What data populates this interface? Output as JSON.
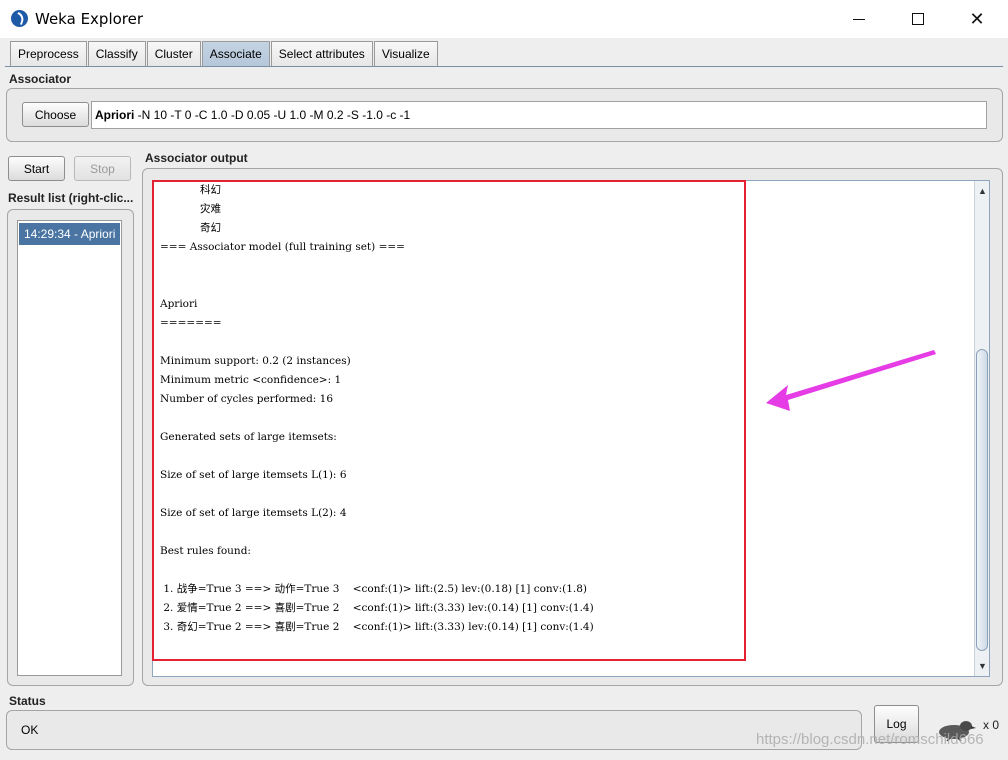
{
  "window": {
    "title": "Weka Explorer",
    "controls": {
      "minimize": "minimize-icon",
      "maximize": "maximize-icon",
      "close": "close-icon"
    }
  },
  "tabs": [
    {
      "label": "Preprocess",
      "active": false
    },
    {
      "label": "Classify",
      "active": false
    },
    {
      "label": "Cluster",
      "active": false
    },
    {
      "label": "Associate",
      "active": true
    },
    {
      "label": "Select attributes",
      "active": false
    },
    {
      "label": "Visualize",
      "active": false
    }
  ],
  "associator": {
    "section_label": "Associator",
    "choose_label": "Choose",
    "algorithm": "Apriori",
    "options": " -N 10 -T 0 -C 1.0 -D 0.05 -U 1.0 -M 0.2 -S -1.0 -c -1"
  },
  "controls": {
    "start_label": "Start",
    "stop_label": "Stop"
  },
  "result_list": {
    "label": "Result list (right-clic...",
    "items": [
      "14:29:34 - Apriori"
    ]
  },
  "output": {
    "label": "Associator output",
    "lines": [
      "            科幻",
      "            灾难",
      "            奇幻",
      "=== Associator model (full training set) ===",
      "",
      "",
      "Apriori",
      "=======",
      "",
      "Minimum support: 0.2 (2 instances)",
      "Minimum metric <confidence>: 1",
      "Number of cycles performed: 16",
      "",
      "Generated sets of large itemsets:",
      "",
      "Size of set of large itemsets L(1): 6",
      "",
      "Size of set of large itemsets L(2): 4",
      "",
      "Best rules found:",
      "",
      " 1. 战争=True 3 ==> 动作=True 3    <conf:(1)> lift:(2.5) lev:(0.18) [1] conv:(1.8)",
      " 2. 爱情=True 2 ==> 喜剧=True 2    <conf:(1)> lift:(3.33) lev:(0.14) [1] conv:(1.4)",
      " 3. 奇幻=True 2 ==> 喜剧=True 2    <conf:(1)> lift:(3.33) lev:(0.14) [1] conv:(1.4)"
    ],
    "scroll": {
      "up": "▲",
      "down": "▼"
    }
  },
  "annotations": {
    "highlight_color": "#e52232",
    "arrow_color": "#e53ce6"
  },
  "status": {
    "label": "Status",
    "text": "OK",
    "log_label": "Log",
    "task_count": "x 0"
  },
  "watermark": "https://blog.csdn.net/romschild666"
}
